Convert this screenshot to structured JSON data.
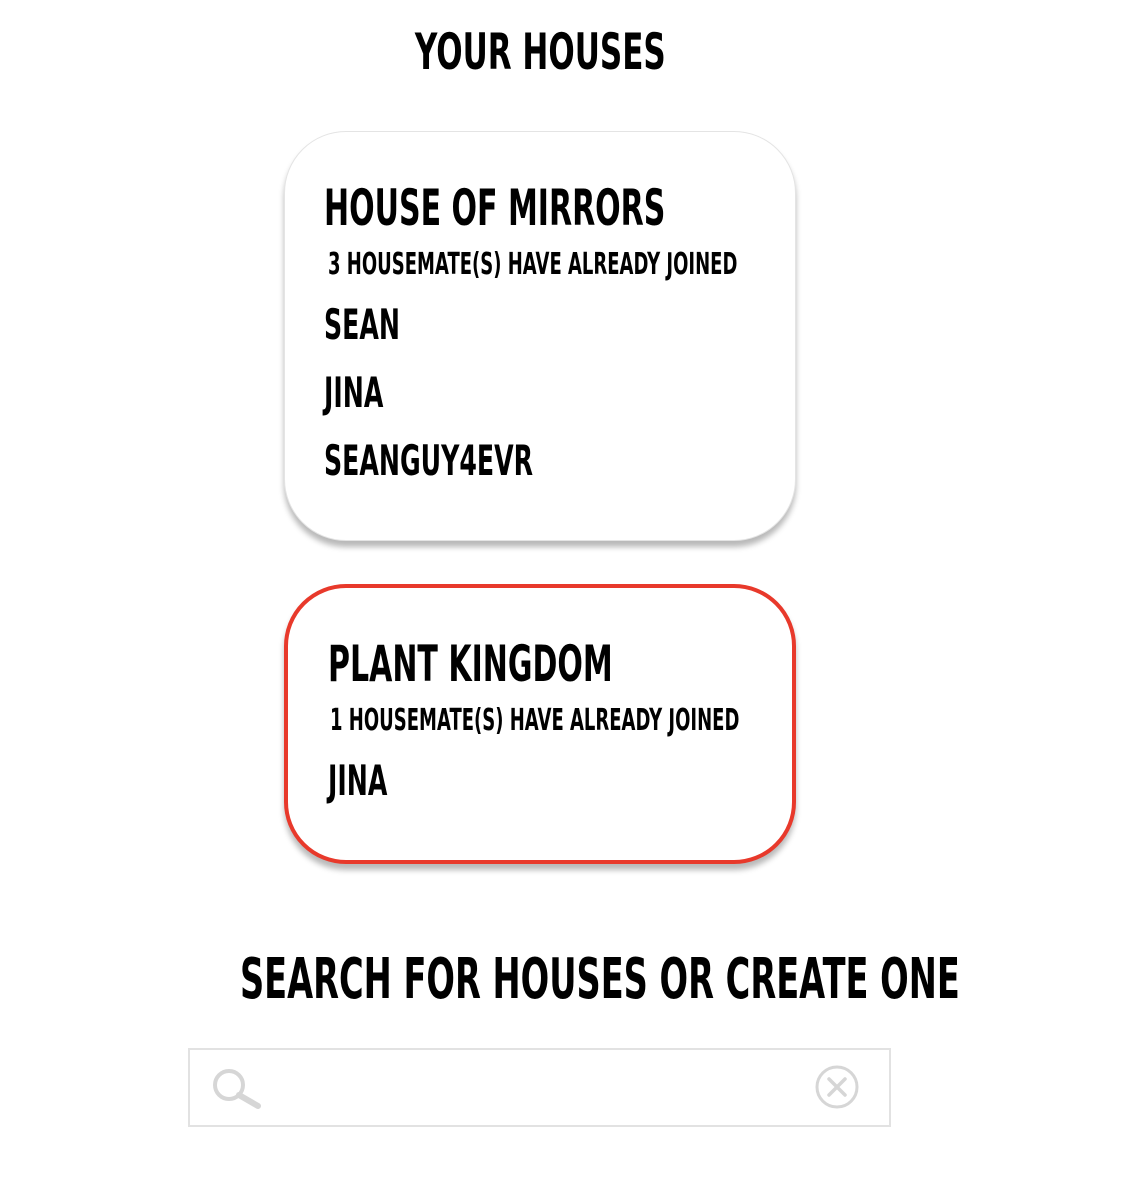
{
  "header": {
    "title": "YOUR HOUSES"
  },
  "houses": [
    {
      "name": "HOUSE OF MIRRORS",
      "count_text": "3 HOUSEMATE(S) HAVE ALREADY JOINED",
      "members": [
        "SEAN",
        "JINA",
        "SEANGUY4EVR"
      ],
      "selected": false
    },
    {
      "name": "PLANT KINGDOM",
      "count_text": "1 HOUSEMATE(S) HAVE ALREADY JOINED",
      "members": [
        "JINA"
      ],
      "selected": true
    }
  ],
  "search": {
    "heading": "SEARCH FOR HOUSES OR CREATE ONE",
    "value": "",
    "placeholder": "",
    "search_icon": "search-icon",
    "clear_icon": "clear-icon"
  },
  "colors": {
    "selected_border": "#e8392b",
    "card_border": "#e4e4e4",
    "icon_gray": "#d6d6d6"
  }
}
